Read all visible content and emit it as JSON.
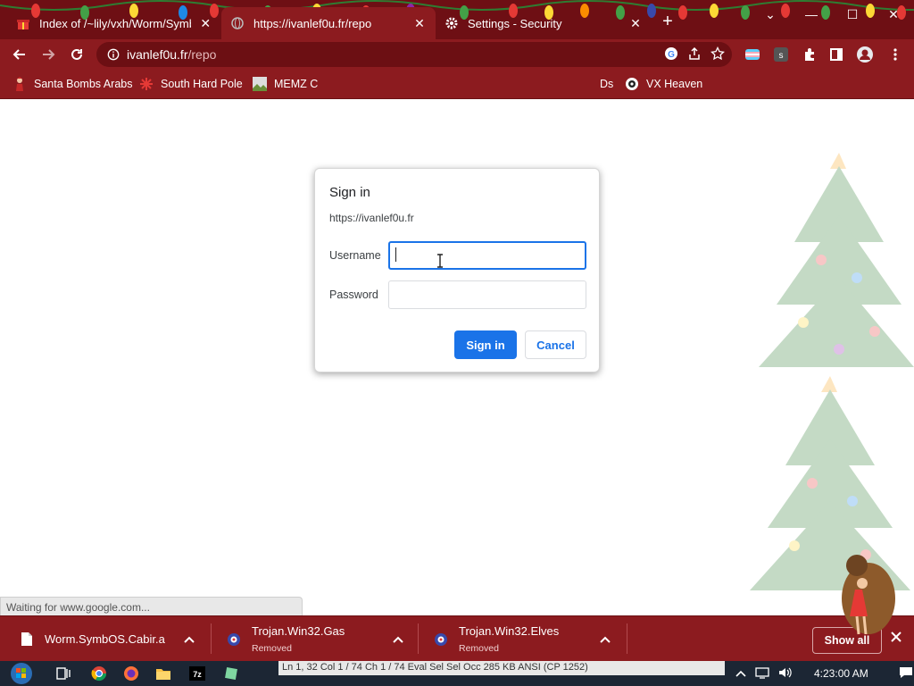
{
  "tabs": [
    {
      "title": "Index of /~lily/vxh/Worm/Symb",
      "close": "✕"
    },
    {
      "title": "https://ivanlef0u.fr/repo",
      "close": "✕"
    },
    {
      "title": "Settings - Security",
      "close": "✕"
    }
  ],
  "new_tab": "+",
  "window_controls": {
    "tabsearch": "⌄",
    "minimize": "—",
    "maximize": "☐",
    "close": "✕"
  },
  "address": {
    "host": "ivanlef0u.fr",
    "path": "/repo"
  },
  "bookmarks": [
    {
      "label": "Santa Bombs Arabs"
    },
    {
      "label": "South Hard Pole"
    },
    {
      "label": "MEMZ C"
    },
    {
      "label": "Ds"
    },
    {
      "label": "VX Heaven"
    }
  ],
  "dialog": {
    "title": "Sign in",
    "origin": "https://ivanlef0u.fr",
    "username_label": "Username",
    "username_value": "",
    "password_label": "Password",
    "password_value": "",
    "signin_label": "Sign in",
    "cancel_label": "Cancel"
  },
  "status_text": "Waiting for www.google.com...",
  "downloads": [
    {
      "name": "Worm.SymbOS.Cabir.a",
      "status": ""
    },
    {
      "name": "Trojan.Win32.Gas",
      "status": "Removed"
    },
    {
      "name": "Trojan.Win32.Elves",
      "status": "Removed"
    }
  ],
  "downloads_show_all": "Show all",
  "taskbar": {
    "clock": "4:23:00 AM",
    "ghost_text": "Ln 1, 32   Col 1 / 74   Ch 1 / 74   Eval   Sel   Sel   Occ   285 KB   ANSI (CP 1252)"
  },
  "colors": {
    "chrome": "#8c1b1f",
    "tabstrip": "#6e0f14",
    "accent": "#1a73e8"
  }
}
